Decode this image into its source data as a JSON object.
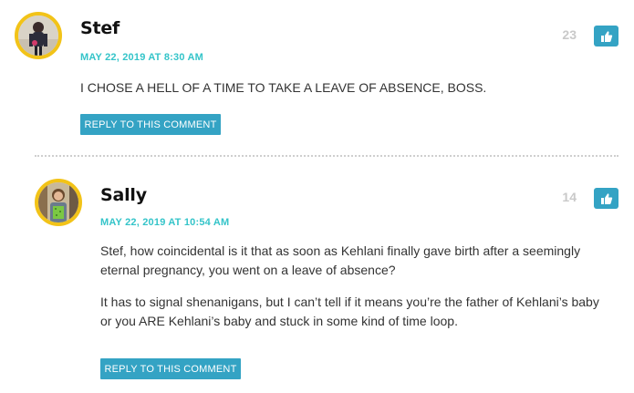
{
  "comments": [
    {
      "author": "Stef",
      "date": "MAY 22, 2019 AT 8:30 AM",
      "votes": "23",
      "body": [
        "I CHOSE A HELL OF A TIME TO TAKE A LEAVE OF ABSENCE, BOSS."
      ],
      "reply_label": "REPLY TO THIS COMMENT",
      "like_icon": "thumbs-up-icon"
    },
    {
      "author": "Sally",
      "date": "MAY 22, 2019 AT 10:54 AM",
      "votes": "14",
      "body": [
        "Stef, how coincidental is it that as soon as Kehlani finally gave birth after a seemingly eternal pregnancy, you went on a leave of absence?",
        "It has to signal shenanigans, but I can’t tell if it means you’re the father of Kehlani’s baby or you ARE Kehlani’s baby and stuck in some kind of time loop."
      ],
      "reply_label": "REPLY TO THIS COMMENT",
      "like_icon": "thumbs-up-icon"
    }
  ],
  "colors": {
    "accent_teal": "#34c4c9",
    "button_blue": "#34a3c4",
    "avatar_ring": "#f2c318"
  }
}
